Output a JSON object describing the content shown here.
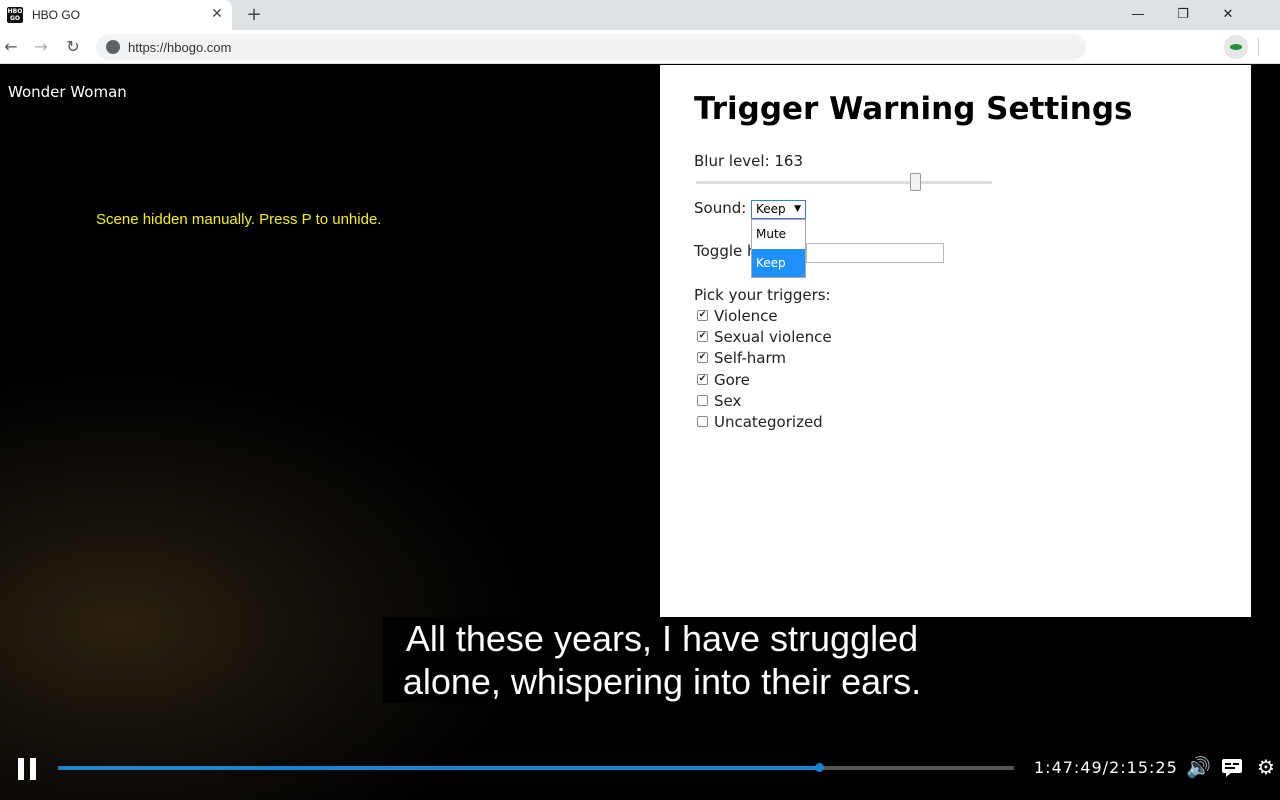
{
  "browser": {
    "tab_title": "HBO GO",
    "favicon_text": "HBO GO",
    "url": "https://hbogo.com",
    "new_tab_glyph": "+",
    "close_glyph": "✕"
  },
  "video": {
    "title": "Wonder Woman",
    "hidden_message": "Scene hidden manually. Press P to unhide.",
    "subtitle_line1": "All these years, I have struggled",
    "subtitle_line2": "alone, whispering into their ears.",
    "time": "1:47:49/2:15:25",
    "progress_fraction": 0.796
  },
  "settings": {
    "title": "Trigger Warning Settings",
    "blur_label": "Blur level: 163",
    "blur_value": 163,
    "blur_fraction": 0.74,
    "sound_label": "Sound:",
    "sound_selected": "Keep",
    "sound_options": [
      "Mute",
      "Keep"
    ],
    "toggle_label": "Toggle h",
    "triggers_label": "Pick your triggers:",
    "triggers": [
      {
        "label": "Violence",
        "checked": true
      },
      {
        "label": "Sexual violence",
        "checked": true
      },
      {
        "label": "Self-harm",
        "checked": true
      },
      {
        "label": "Gore",
        "checked": true
      },
      {
        "label": "Sex",
        "checked": false
      },
      {
        "label": "Uncategorized",
        "checked": false
      }
    ]
  },
  "icons": {
    "back": "arrow-left-icon",
    "forward": "arrow-right-icon",
    "reload": "reload-icon",
    "minimize": "minimize-icon",
    "restore": "restore-icon",
    "close": "close-icon",
    "volume": "volume-icon",
    "captions": "captions-icon",
    "settings": "gear-icon"
  },
  "colors": {
    "progress": "#1a84d4",
    "hidden_message": "#f4f000",
    "dropdown_selected": "#1e90ff"
  }
}
